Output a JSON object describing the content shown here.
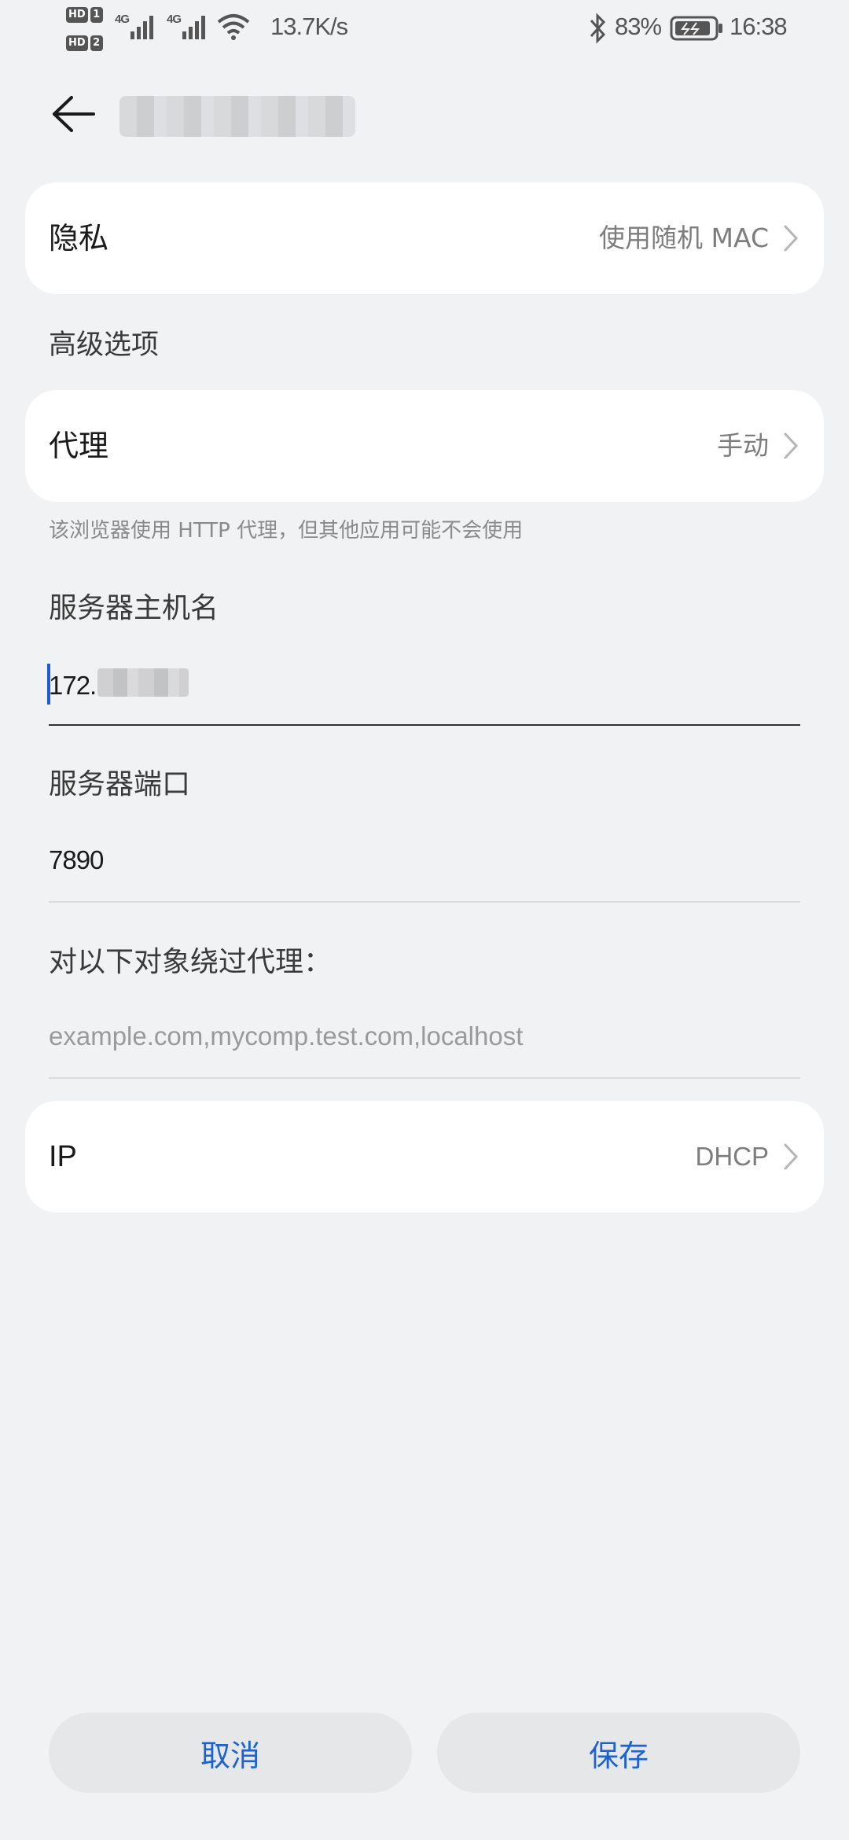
{
  "status_bar": {
    "hd1": "HD",
    "sim1": "1",
    "hd2": "HD",
    "sim2": "2",
    "net1": "4G",
    "net2": "4G",
    "speed": "13.7K/s",
    "battery": "83%",
    "time": "16:38",
    "icons": [
      "signal-icon",
      "signal-icon",
      "wifi-icon",
      "bluetooth-icon",
      "battery-icon"
    ]
  },
  "header": {
    "back_icon": "arrow-left-icon"
  },
  "privacy": {
    "label": "隐私",
    "value": "使用随机 MAC"
  },
  "advanced": {
    "title": "高级选项"
  },
  "proxy": {
    "label": "代理",
    "value": "手动",
    "hint": "该浏览器使用 HTTP 代理，但其他应用可能不会使用"
  },
  "host": {
    "label": "服务器主机名",
    "value": "172."
  },
  "port": {
    "label": "服务器端口",
    "value": "7890"
  },
  "bypass": {
    "label": "对以下对象绕过代理：",
    "placeholder": "example.com,mycomp.test.com,localhost"
  },
  "ip": {
    "label": "IP",
    "value": "DHCP"
  },
  "buttons": {
    "cancel": "取消",
    "save": "保存"
  },
  "colors": {
    "accent": "#1d62d2",
    "background": "#f1f2f3",
    "card": "#ffffff"
  }
}
